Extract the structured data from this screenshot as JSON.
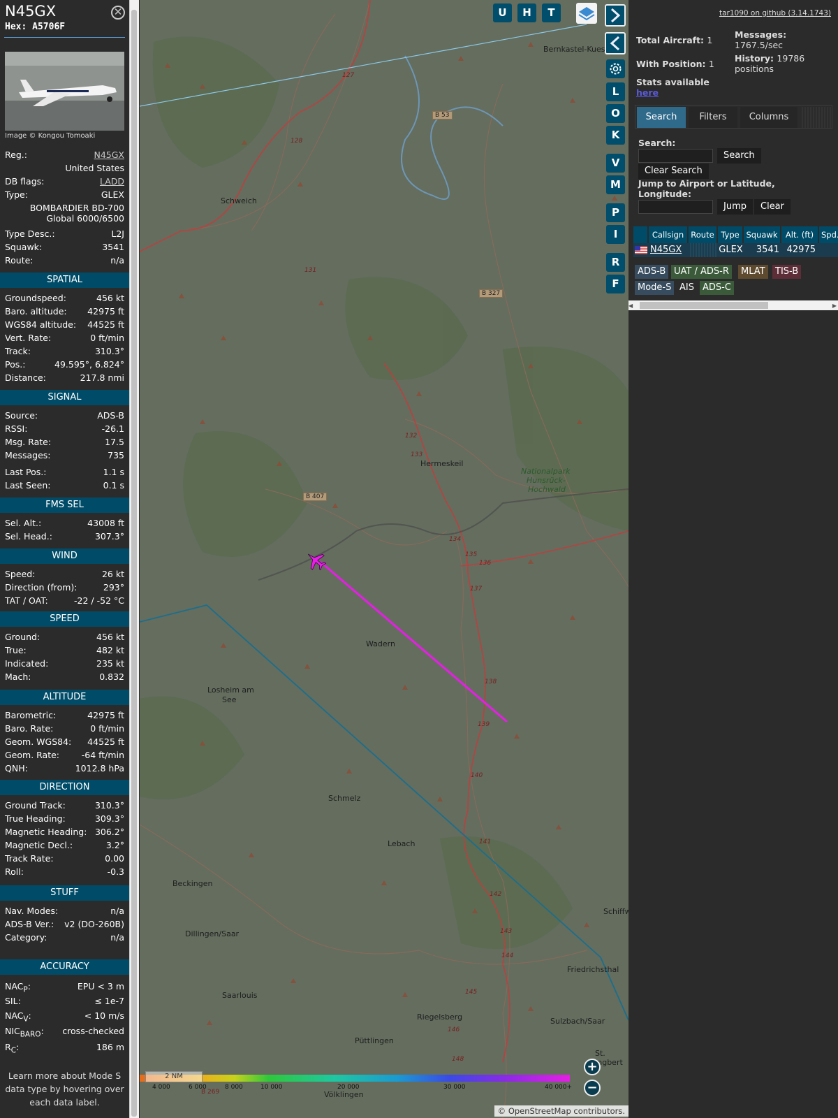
{
  "aircraft": {
    "callsign": "N45GX",
    "hex_label": "Hex:",
    "hex": "A5706F",
    "photo_credit": "Image © Kongou Tomoaki"
  },
  "info": [
    {
      "label": "Reg.:",
      "value": "N45GX",
      "link": true
    },
    {
      "label": "",
      "value": "United States"
    },
    {
      "label": "DB flags:",
      "value": "LADD",
      "link": true
    },
    {
      "label": "Type:",
      "value": "GLEX"
    },
    {
      "label": "",
      "value": "BOMBARDIER BD-700"
    },
    {
      "label": "",
      "value": "Global 6000/6500"
    },
    {
      "label": "Type Desc.:",
      "value": "L2J"
    },
    {
      "label": "Squawk:",
      "value": "3541"
    },
    {
      "label": "Route:",
      "value": "n/a"
    }
  ],
  "sections": {
    "spatial": {
      "title": "SPATIAL",
      "rows": [
        [
          "Groundspeed:",
          "456 kt"
        ],
        [
          "Baro. altitude:",
          "42975 ft"
        ],
        [
          "WGS84 altitude:",
          "44525 ft"
        ],
        [
          "Vert. Rate:",
          "0 ft/min"
        ],
        [
          "Track:",
          "310.3°"
        ],
        [
          "Pos.:",
          "49.595°, 6.824°"
        ],
        [
          "Distance:",
          "217.8 nmi"
        ]
      ]
    },
    "signal": {
      "title": "SIGNAL",
      "rows": [
        [
          "Source:",
          "ADS-B"
        ],
        [
          "RSSI:",
          "-26.1"
        ],
        [
          "Msg. Rate:",
          "17.5"
        ],
        [
          "Messages:",
          "735"
        ],
        [
          "Last Pos.:",
          "1.1 s"
        ],
        [
          "Last Seen:",
          "0.1 s"
        ]
      ]
    },
    "fms": {
      "title": "FMS SEL",
      "rows": [
        [
          "Sel. Alt.:",
          "43008 ft"
        ],
        [
          "Sel. Head.:",
          "307.3°"
        ]
      ]
    },
    "wind": {
      "title": "WIND",
      "rows": [
        [
          "Speed:",
          "26 kt"
        ],
        [
          "Direction (from):",
          "293°"
        ],
        [
          "TAT / OAT:",
          "-22 / -52 °C"
        ]
      ]
    },
    "speed": {
      "title": "SPEED",
      "rows": [
        [
          "Ground:",
          "456 kt"
        ],
        [
          "True:",
          "482 kt"
        ],
        [
          "Indicated:",
          "235 kt"
        ],
        [
          "Mach:",
          "0.832"
        ]
      ]
    },
    "altitude": {
      "title": "ALTITUDE",
      "rows": [
        [
          "Barometric:",
          "42975 ft"
        ],
        [
          "Baro. Rate:",
          "0 ft/min"
        ],
        [
          "Geom. WGS84:",
          "44525 ft"
        ],
        [
          "Geom. Rate:",
          "-64 ft/min"
        ],
        [
          "QNH:",
          "1012.8 hPa"
        ]
      ]
    },
    "direction": {
      "title": "DIRECTION",
      "rows": [
        [
          "Ground Track:",
          "310.3°"
        ],
        [
          "True Heading:",
          "309.3°"
        ],
        [
          "Magnetic Heading:",
          "306.2°"
        ],
        [
          "Magnetic Decl.:",
          "3.2°"
        ],
        [
          "Track Rate:",
          "0.00"
        ],
        [
          "Roll:",
          "-0.3"
        ]
      ]
    },
    "stuff": {
      "title": "STUFF",
      "rows": [
        [
          "Nav. Modes:",
          "n/a"
        ],
        [
          "ADS-B Ver.:",
          "v2 (DO-260B)"
        ],
        [
          "Category:",
          "n/a"
        ]
      ]
    },
    "accuracy": {
      "title": "ACCURACY"
    }
  },
  "accuracy": {
    "nacp_label": "NAC",
    "nacp_sub": "P",
    "nacp_colon": ":",
    "nacp": "EPU < 3 m",
    "sil_label": "SIL:",
    "sil": "≤ 1e-7",
    "nacv_label": "NAC",
    "nacv_sub": "V",
    "nacv_colon": ":",
    "nacv": "< 10 m/s",
    "nic_label": "NIC",
    "nic_sub": "BARO",
    "nic_colon": ":",
    "nic": "cross-checked",
    "rc_label": "R",
    "rc_sub": "C",
    "rc_colon": ":",
    "rc": "186 m"
  },
  "footer": [
    "Learn more about Mode S",
    "data type by hovering over",
    "each data label."
  ],
  "map": {
    "buttons": {
      "u": "U",
      "h": "H",
      "t": "T",
      "l": "L",
      "o": "O",
      "k": "K",
      "v": "V",
      "m": "M",
      "p": "P",
      "i": "I",
      "r": "R",
      "f": "F"
    },
    "scale": "2 NM",
    "attribution": "© OpenStreetMap contributors.",
    "altitude_legend": [
      "4 000",
      "6 000",
      "8 000",
      "10 000",
      "20 000",
      "30 000",
      "40 000+"
    ],
    "places": [
      "Bernkastel-Kues",
      "Schweich",
      "Hermeskeil",
      "Nationalpark",
      "Hunsrück-",
      "Hochwald",
      "Wadern",
      "Losheim am",
      "See",
      "Schmelz",
      "Lebach",
      "Beckingen",
      "Dillingen/Saar",
      "Saarlouis",
      "Riegelsberg",
      "Püttlingen",
      "Völklingen",
      "Sulzbach/Saar",
      "Friedrichsthal",
      "St. Ingbert",
      "Schiffw"
    ],
    "roads": [
      "B 53",
      "B 327",
      "B 407",
      "B 269",
      "132",
      "133",
      "134",
      "135",
      "136",
      "137",
      "138",
      "139",
      "140",
      "141",
      "142",
      "143",
      "144",
      "145",
      "146",
      "148",
      "131",
      "128",
      "127"
    ]
  },
  "panel": {
    "github": "tar1090 on github (3.14.1743)",
    "total_label": "Total Aircraft:",
    "total": "1",
    "withpos_label": "With Position:",
    "withpos": "1",
    "stats_label": "Stats available",
    "stats_link": "here",
    "messages_label": "Messages:",
    "messages": "1767.5/sec",
    "history_label": "History:",
    "history": "19786",
    "history_unit": "positions",
    "tabs": [
      "Search",
      "Filters",
      "Columns"
    ],
    "search_label": "Search:",
    "search_btn": "Search",
    "clear_search": "Clear Search",
    "jump_label": "Jump to Airport or Latitude, Longitude:",
    "jump_btn": "Jump",
    "clear_btn": "Clear",
    "columns": [
      "Callsign",
      "Route",
      "Type",
      "Squawk",
      "Alt. (ft)",
      "Spd."
    ],
    "row": {
      "callsign": "N45GX",
      "route": "",
      "type": "GLEX",
      "squawk": "3541",
      "alt": "42975"
    },
    "sources": [
      "ADS-B",
      "UAT / ADS-R",
      "MLAT",
      "TIS-B",
      "Mode-S",
      "AIS",
      "ADS-C"
    ]
  },
  "colors": {
    "accent": "#004c68",
    "track": "#e61ee6",
    "route_line": "#1a6e8e"
  }
}
